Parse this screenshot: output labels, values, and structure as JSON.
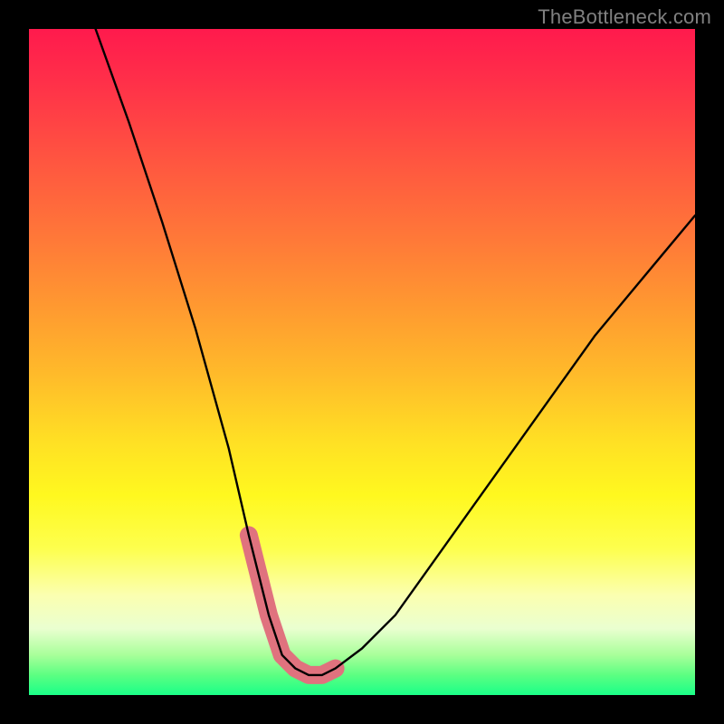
{
  "watermark": "TheBottleneck.com",
  "chart_data": {
    "type": "line",
    "title": "",
    "xlabel": "",
    "ylabel": "",
    "xlim": [
      0,
      100
    ],
    "ylim": [
      0,
      100
    ],
    "note": "No axes, ticks, or labels are rendered in the image. The curve resembles a bottleneck/valley: steep drop from top-left to a flat minimum near the bottom center-left, then a slower rise toward the upper-right. Values approximate pixel-read positions on a 0–100 normalized grid (y measured from bottom).",
    "series": [
      {
        "name": "bottleneck-curve",
        "x": [
          10,
          15,
          20,
          25,
          30,
          33,
          36,
          38,
          40,
          42,
          44,
          46,
          50,
          55,
          60,
          65,
          70,
          75,
          80,
          85,
          90,
          95,
          100
        ],
        "y": [
          100,
          86,
          71,
          55,
          37,
          24,
          12,
          6,
          4,
          3,
          3,
          4,
          7,
          12,
          19,
          26,
          33,
          40,
          47,
          54,
          60,
          66,
          72
        ]
      }
    ],
    "highlight": {
      "name": "valley-highlight",
      "color": "#e0727e",
      "description": "Thick pinkish stroke emphasizing the near-minimum region of the curve.",
      "x": [
        33,
        36,
        38,
        40,
        42,
        44,
        46
      ],
      "y": [
        24,
        12,
        6,
        4,
        3,
        3,
        4
      ]
    },
    "background_gradient": {
      "direction": "top-to-bottom",
      "description": "Red at top through orange/yellow to green at bottom, implying lower y-values are better (green zone).",
      "stops": [
        {
          "pos": 0.0,
          "color": "#ff1a4d"
        },
        {
          "pos": 0.4,
          "color": "#ff9a30"
        },
        {
          "pos": 0.7,
          "color": "#fff81f"
        },
        {
          "pos": 0.92,
          "color": "#a8ff9a"
        },
        {
          "pos": 1.0,
          "color": "#1aff88"
        }
      ]
    }
  }
}
